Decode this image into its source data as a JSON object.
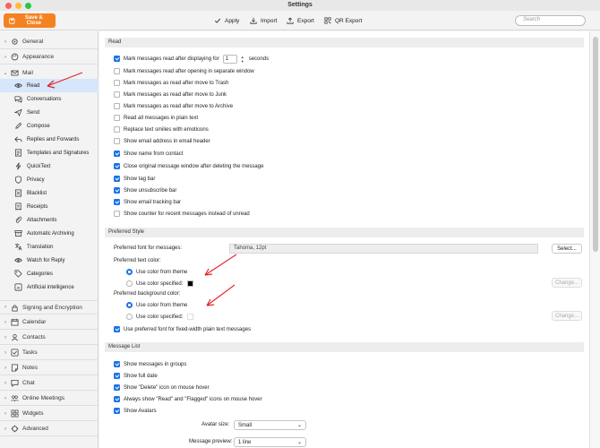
{
  "window": {
    "title": "Settings"
  },
  "toolbar": {
    "save_close": "Save & Close",
    "apply": "Apply",
    "import": "Import",
    "export": "Export",
    "qr_export": "QR Export",
    "search_placeholder": "Search"
  },
  "sidebar": {
    "general": "General",
    "appearance": "Appearance",
    "mail": "Mail",
    "mail_items": [
      "Read",
      "Conversations",
      "Send",
      "Compose",
      "Replies and Forwards",
      "Templates and Signatures",
      "QuickText",
      "Privacy",
      "Blacklist",
      "Receipts",
      "Attachments",
      "Automatic Archiving",
      "Translation",
      "Watch for Reply",
      "Categories",
      "Artificial intelligence"
    ],
    "groups_after": [
      "Signing and Encryption",
      "Calendar",
      "Contacts",
      "Tasks",
      "Notes",
      "Chat",
      "Online Meetings",
      "Widgets",
      "Advanced"
    ]
  },
  "read": {
    "header": "Read",
    "mark_after_prefix": "Mark messages read after displaying for",
    "mark_after_value": "1",
    "mark_after_suffix": "seconds",
    "options": [
      "Mark messages read after opening in separate window",
      "Mark messages as read after move to Trash",
      "Mark messages as read after move to Junk",
      "Mark messages as read after move to Archive",
      "Read all messages in plain text",
      "Replace text smilies with emoticons",
      "Show email address in email header",
      "Show name from contact",
      "Close original message window after deleting the message",
      "Show tag bar",
      "Show unsubscribe bar",
      "Show email tracking bar",
      "Show counter for recent messages instead of unread"
    ]
  },
  "preferred_style": {
    "header": "Preferred Style",
    "font_label": "Preferred font for messages:",
    "font_value": "Tahoma, 12pt",
    "select_button": "Select...",
    "text_color_label": "Preferred text color:",
    "text_use_theme": "Use color from theme",
    "text_use_specified": "Use color specified:",
    "change_button": "Change...",
    "bg_color_label": "Preferred background color:",
    "bg_use_theme": "Use color from theme",
    "bg_use_specified": "Use color specified:",
    "fixed_width": "Use preferred font for fixed-width plain text messages",
    "text_swatch_color": "#000000",
    "bg_swatch_color": "#ffffff"
  },
  "message_list": {
    "header": "Message List",
    "options": [
      "Show messages in groups",
      "Show full date",
      "Show \"Delete\" icon on mouse hover",
      "Always show \"Read\" and \"Flagged\" icons on mouse hover",
      "Show Avatars"
    ],
    "avatar_size_label": "Avatar size:",
    "avatar_size_value": "Small",
    "preview_label": "Message preview:",
    "preview_value": "1 line"
  },
  "colors": {
    "accent": "#1a73e8",
    "brand": "#f58220",
    "annotation": "#e0262b"
  }
}
